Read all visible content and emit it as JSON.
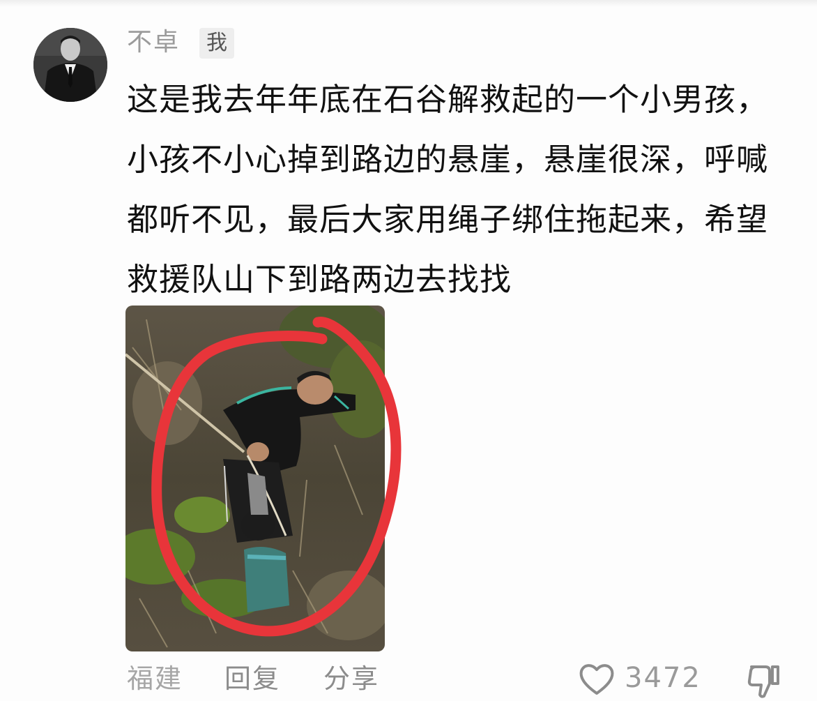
{
  "comment": {
    "author": "不卓",
    "author_tag": "我",
    "text": "这是我去年年底在石谷解救起的一个小男孩，小孩不小心掉到路边的悬崖，悬崖很深，呼喊都听不见，最后大家用绳子绑住拖起来，希望救援队山下到路两边去找找",
    "location": "福建",
    "reply_label": "回复",
    "share_label": "分享",
    "like_count": "3472"
  },
  "icons": {
    "like": "heart-outline-icon",
    "dislike": "thumbs-down-outline-icon"
  },
  "colors": {
    "annotation_circle": "#e8353a",
    "text_primary": "#111111",
    "text_secondary": "#9b9b9b"
  }
}
